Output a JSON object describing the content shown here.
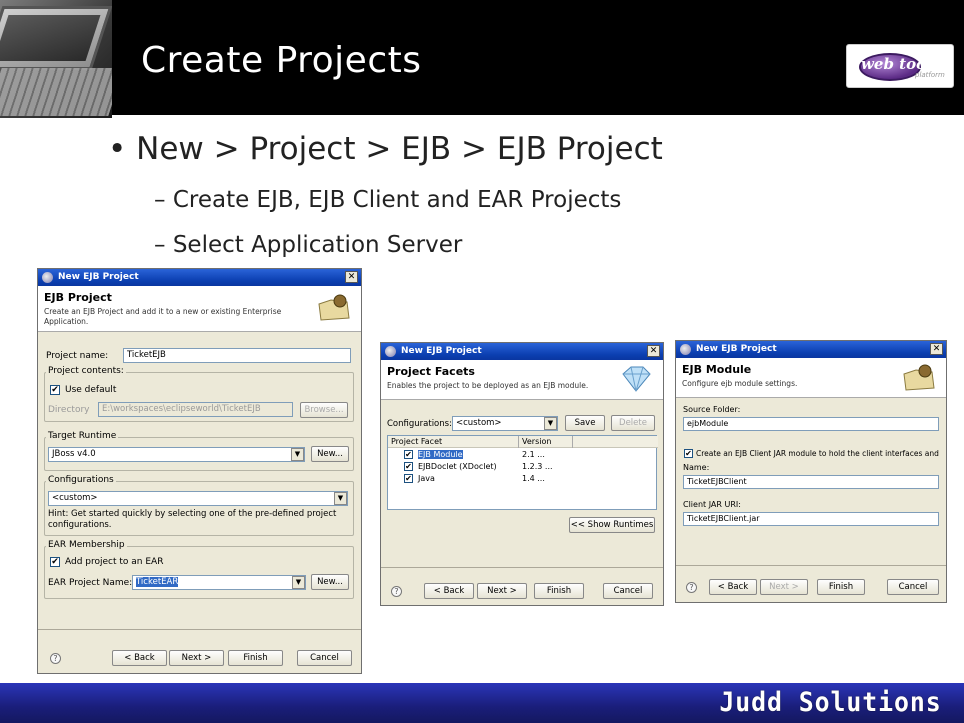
{
  "slide": {
    "title": "Create Projects",
    "brand": "Judd Solutions",
    "logo": {
      "text": "web tools",
      "sub": "platform"
    }
  },
  "bullets": [
    {
      "text": "New > Project > EJB > EJB Project"
    },
    {
      "text": "Create EJB, EJB Client and EAR Projects"
    },
    {
      "text": "Select Application Server"
    }
  ],
  "dialog1": {
    "window_title": "New EJB Project",
    "heading": "EJB Project",
    "description": "Create an EJB Project and add it to a new or existing Enterprise Application.",
    "project_name_label": "Project name:",
    "project_name_value": "TicketEJB",
    "project_contents_label": "Project contents:",
    "use_default_label": "Use default",
    "directory_label": "Directory",
    "directory_value": "E:\\workspaces\\eclipseworld\\TicketEJB",
    "browse_label": "Browse...",
    "target_runtime_label": "Target Runtime",
    "target_runtime_value": "JBoss v4.0",
    "new_label": "New...",
    "configurations_label": "Configurations",
    "configurations_value": "<custom>",
    "hint": "Hint: Get started quickly by selecting one of the pre-defined project configurations.",
    "ear_membership_label": "EAR Membership",
    "add_to_ear_label": "Add project to an EAR",
    "ear_project_name_label": "EAR Project Name:",
    "ear_project_name_value": "TicketEAR",
    "back": "< Back",
    "next": "Next >",
    "finish": "Finish",
    "cancel": "Cancel",
    "help": "?"
  },
  "dialog2": {
    "window_title": "New EJB Project",
    "heading": "Project Facets",
    "description": "Enables the project to be deployed as an EJB module.",
    "configurations_label": "Configurations:",
    "configurations_value": "<custom>",
    "save": "Save",
    "delete": "Delete",
    "columns": [
      "Project Facet",
      "Version"
    ],
    "facets": [
      {
        "name": "EJB Module",
        "version": "2.1 ..."
      },
      {
        "name": "EJBDoclet (XDoclet)",
        "version": "1.2.3 ..."
      },
      {
        "name": "Java",
        "version": "1.4 ..."
      }
    ],
    "show_runtimes": "<< Show Runtimes",
    "back": "< Back",
    "next": "Next >",
    "finish": "Finish",
    "cancel": "Cancel",
    "help": "?"
  },
  "dialog3": {
    "window_title": "New EJB Project",
    "heading": "EJB Module",
    "description": "Configure ejb module settings.",
    "source_folder_label": "Source Folder:",
    "source_folder_value": "ejbModule",
    "create_client_label": "Create an EJB Client JAR module to hold the client interfaces and",
    "name_label": "Name:",
    "name_value": "TicketEJBClient",
    "client_jar_uri_label": "Client JAR URI:",
    "client_jar_uri_value": "TicketEJBClient.jar",
    "back": "< Back",
    "next": "Next >",
    "finish": "Finish",
    "cancel": "Cancel",
    "help": "?"
  },
  "colors": {
    "header_bg": "#000000",
    "footer_bg": "#1a1e7a",
    "titlebar": "#0b3fb0",
    "dialog_bg": "#ece9d8"
  }
}
